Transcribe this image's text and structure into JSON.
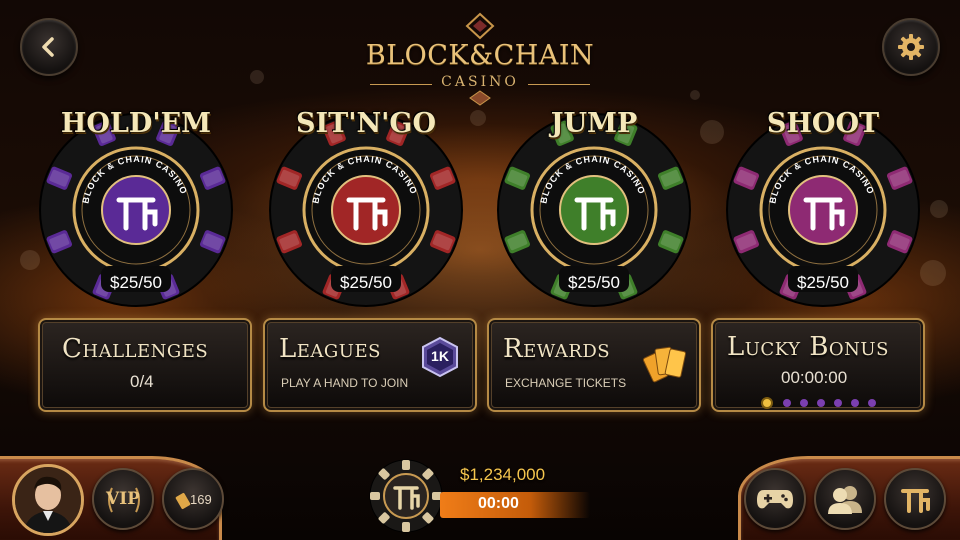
{
  "logo": {
    "title": "BLOCK&CHAIN",
    "subtitle": "CASINO"
  },
  "games": [
    {
      "title": "HOLD'EM",
      "stakes": "$25/50",
      "color": "#5a2a96",
      "chip_text": "BLOCK & CHAIN CASINO"
    },
    {
      "title": "SIT'N'GO",
      "stakes": "$25/50",
      "color": "#a12626",
      "chip_text": "BLOCK & CHAIN CASINO"
    },
    {
      "title": "JUMP",
      "stakes": "$25/50",
      "color": "#3f7f2a",
      "chip_text": "BLOCK & CHAIN CASINO"
    },
    {
      "title": "SHOOT",
      "stakes": "$25/50",
      "color": "#8e2a73",
      "chip_text": "BLOCK & CHAIN CASINO"
    }
  ],
  "panels": {
    "challenges": {
      "title": "Challenges",
      "value": "0/4"
    },
    "leagues": {
      "title": "Leagues",
      "subtitle": "PLAY A HAND TO JOIN",
      "badge": "1K"
    },
    "rewards": {
      "title": "Rewards",
      "subtitle": "EXCHANGE TICKETS"
    },
    "lucky_bonus": {
      "title": "Lucky Bonus",
      "timer": "00:00:00",
      "dots_total": 7,
      "dots_active": 1
    }
  },
  "bottom": {
    "vip_label": "VIP",
    "tickets": "169",
    "balance": "$1,234,000",
    "timer": "00:00"
  },
  "icons": {
    "back": "chevron-left-icon",
    "settings": "gear-icon",
    "games": "gamepad-icon",
    "friends": "friends-icon",
    "brand": "brand-logo-icon"
  },
  "colors": {
    "gold": "#e9c27a",
    "orange": "#f07d18",
    "balance": "#f6c64e"
  }
}
